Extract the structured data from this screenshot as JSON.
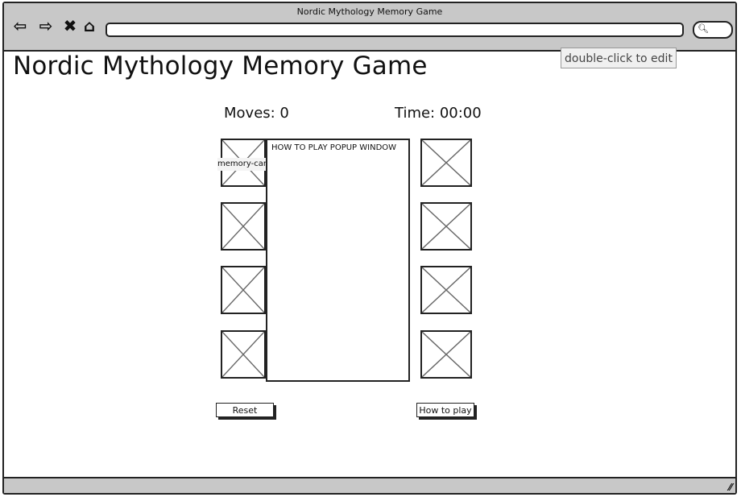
{
  "window": {
    "title": "Nordic Mythology Memory Game"
  },
  "browser": {
    "icons": [
      "back-arrow-icon",
      "forward-arrow-icon",
      "close-x-icon",
      "home-icon",
      "search-icon",
      "resize-grip-icon"
    ]
  },
  "tooltip": {
    "text": "double-click to edit"
  },
  "page": {
    "title": "Nordic Mythology Memory Game"
  },
  "stats": {
    "moves": "Moves: 0",
    "time": "Time: 00:00"
  },
  "popup": {
    "title": "HOW TO PLAY POPUP WINDOW"
  },
  "cards": {
    "label": "memory-card",
    "count": 8
  },
  "buttons": {
    "reset": "Reset",
    "how_to_play": "How to play"
  }
}
